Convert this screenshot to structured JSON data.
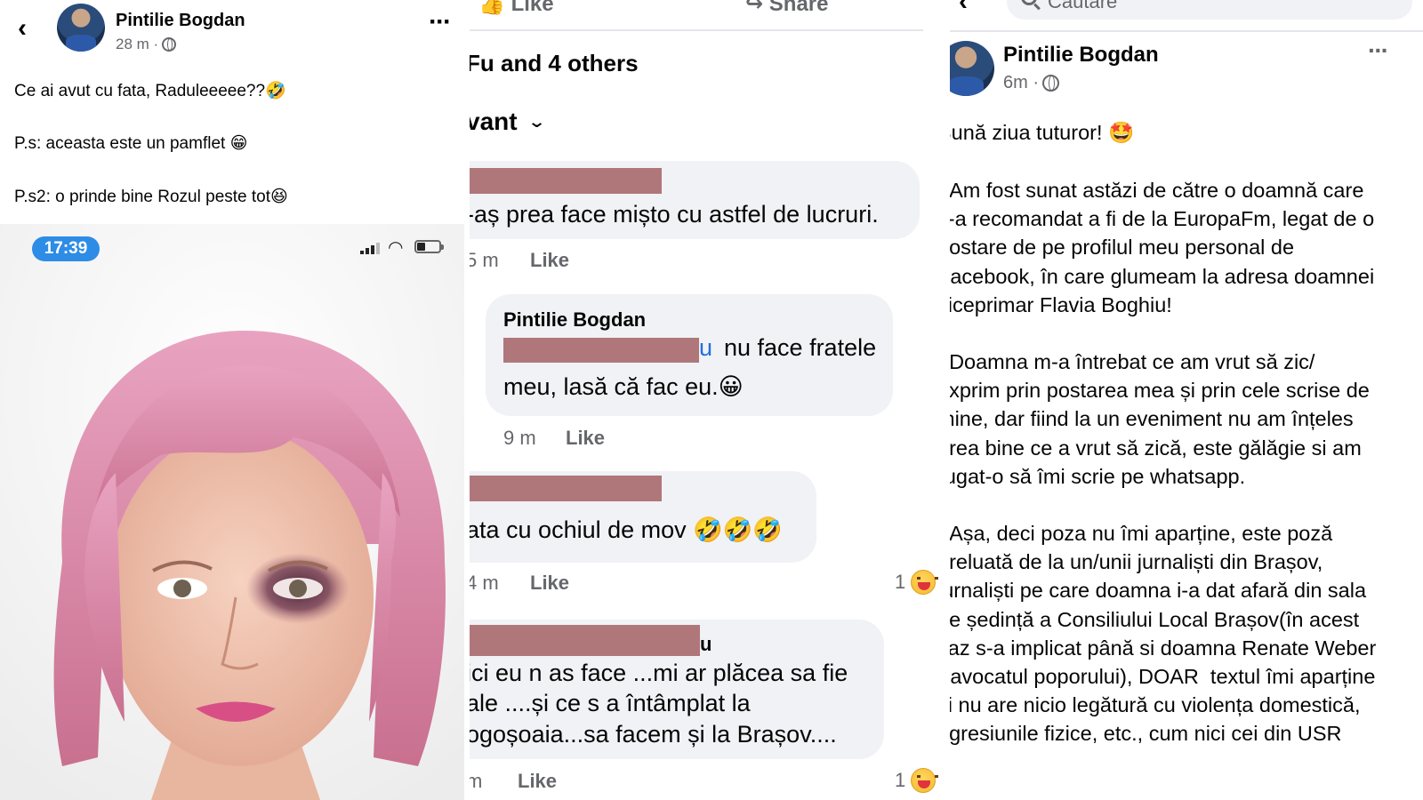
{
  "left": {
    "author": "Pintilie Bogdan",
    "time": "28 m ·",
    "lines": [
      "Ce ai avut cu fata, Raduleeeee??🤣",
      "P.s: aceasta este un pamflet 😁",
      "P.s2: o prinde bine Rozul peste tot😆"
    ],
    "status_time": "17:39"
  },
  "middle": {
    "top_like": "Like",
    "top_share": "Share",
    "reactions": "Fu and 4 others",
    "sort_label": "vant",
    "comments": [
      {
        "text": "-aș prea face mișto cu astfel de lucruri.",
        "time": "5 m",
        "like": "Like"
      },
      {
        "author": "Pintilie Bogdan",
        "mention_tail": "u",
        "text_line1": "nu face fratele",
        "text_line2": "meu, lasă că fac eu.😀",
        "time": "9 m",
        "like": "Like"
      },
      {
        "text": "ata cu ochiul de mov 🤣🤣🤣",
        "time": "4 m",
        "like": "Like",
        "reaction_count": "1"
      },
      {
        "name_tail": "u",
        "lines": [
          "ici eu n as face ...mi ar plăcea sa fie",
          "ale ....și ce s a întâmplat la",
          "ogoșoaia...sa facem și la Brașov...."
        ],
        "time": "m",
        "like": "Like",
        "reaction_count": "1"
      }
    ]
  },
  "right": {
    "search_placeholder": "Căutare",
    "author": "Pintilie Bogdan",
    "time": "6m ·",
    "greeting": "Bună ziua tuturor! 🤩",
    "paragraphs": [
      "  Am fost sunat astăzi de către o doamnă care\ns-a recomandat a fi de la EuropaFm, legat de o\npostare de pe profilul meu personal de\nFacebook, în care glumeam la adresa doamnei\nviceprimar Flavia Boghiu!",
      "  Doamna m-a întrebat ce am vrut să zic/\nexprim prin postarea mea și prin cele scrise de\nmine, dar fiind la un eveniment nu am înțeles\nprea bine ce a vrut să zică, este gălăgie si am\nrugat-o să îmi scrie pe whatsapp.",
      "  Așa, deci poza nu îmi aparține, este poză\npreluată de la un/unii jurnaliști din Brașov,\njurnaliști pe care doamna i-a dat afară din sala\nde ședință a Consiliului Local Brașov(în acest\ncaz s-a implicat până si doamna Renate Weber\n- avocatul poporului), DOAR  textul îmi aparține\nsi nu are nicio legătură cu violența domestică,\nagresiunile fizice, etc., cum nici cei din USR"
    ]
  },
  "colors": {
    "redaction": "#b0777b",
    "bubble": "#f0f2f5",
    "secondary_text": "#65676b",
    "status_pill": "#2d8ce6",
    "mention": "#216fdb"
  }
}
